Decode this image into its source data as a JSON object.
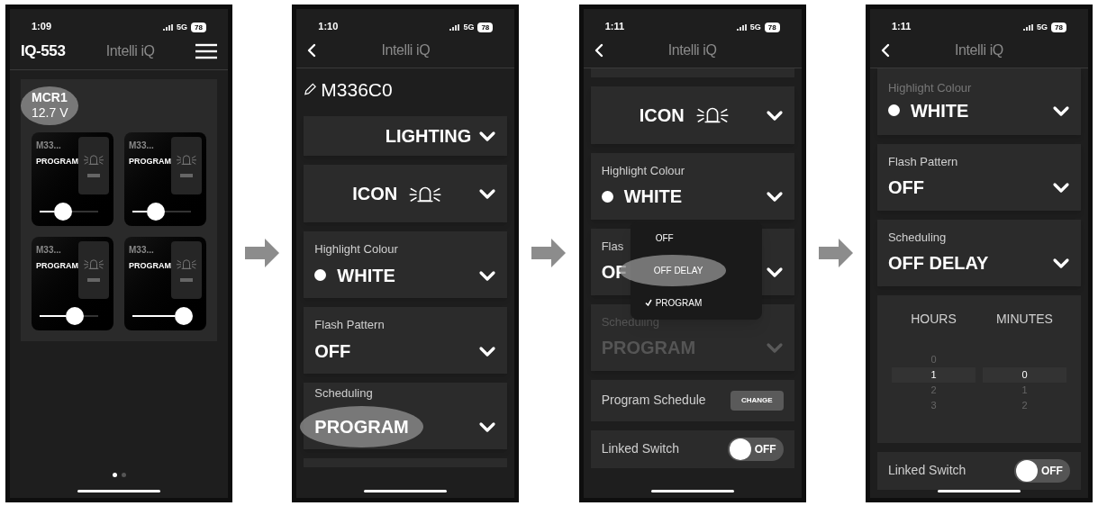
{
  "screens": [
    {
      "kind": "dashboard",
      "status": {
        "time": "1:09",
        "network": "5G",
        "battery": "78"
      },
      "device_code": "IQ-553",
      "app_title": "Intelli iQ",
      "controller": {
        "name": "MCR1",
        "voltage": "12.7 V",
        "highlighted": true
      },
      "switches": [
        {
          "name": "M33...",
          "mode": "PROGRAM",
          "level": 0.24
        },
        {
          "name": "M33...",
          "mode": "PROGRAM",
          "level": 0.24
        },
        {
          "name": "M33...",
          "mode": "PROGRAM",
          "level": 0.44
        },
        {
          "name": "M33...",
          "mode": "PROGRAM",
          "level": 0.73
        }
      ],
      "pages": [
        {
          "selected": true
        },
        {
          "selected": false
        }
      ]
    },
    {
      "kind": "detail",
      "status": {
        "time": "1:10",
        "network": "5G",
        "battery": "78"
      },
      "app_title": "Intelli iQ",
      "switch_name": "M336C0",
      "rows": [
        {
          "kind": "select",
          "value": "LIGHTING",
          "highlighted": false,
          "disabled": false
        },
        {
          "kind": "icon_select",
          "value": "ICON",
          "highlighted": false,
          "disabled": false
        },
        {
          "kind": "select",
          "label": "Highlight Colour",
          "value": "WHITE",
          "color": "#ffffff",
          "highlighted": false,
          "disabled": false
        },
        {
          "kind": "select",
          "label": "Flash Pattern",
          "value": "OFF",
          "highlighted": false,
          "disabled": false
        },
        {
          "kind": "select",
          "label": "Scheduling",
          "value": "PROGRAM",
          "highlighted": true,
          "disabled": false
        },
        {
          "kind": "blank"
        }
      ]
    },
    {
      "kind": "detail",
      "status": {
        "time": "1:11",
        "network": "5G",
        "battery": "78"
      },
      "app_title": "Intelli iQ",
      "rows": [
        {
          "kind": "blank"
        },
        {
          "kind": "icon_select",
          "value": "ICON",
          "highlighted": false,
          "disabled": false
        },
        {
          "kind": "select",
          "label": "Highlight Colour",
          "value": "WHITE",
          "color": "#ffffff",
          "highlighted": false,
          "disabled": false
        },
        {
          "kind": "select",
          "label": "Flas",
          "value": "OF",
          "highlighted": false,
          "disabled": false,
          "menu": [
            {
              "label": "OFF",
              "checked": false,
              "highlighted": false
            },
            {
              "label": "OFF DELAY",
              "checked": false,
              "highlighted": true
            },
            {
              "label": "PROGRAM",
              "checked": true,
              "highlighted": false
            }
          ]
        },
        {
          "kind": "select",
          "label": "Scheduling",
          "value": "PROGRAM",
          "highlighted": false,
          "disabled": true
        },
        {
          "kind": "button",
          "label": "Program Schedule",
          "button": "CHANGE"
        },
        {
          "kind": "toggle",
          "label": "Linked Switch",
          "on": false,
          "state": "OFF"
        }
      ]
    },
    {
      "kind": "detail",
      "status": {
        "time": "1:11",
        "network": "5G",
        "battery": "78"
      },
      "app_title": "Intelli iQ",
      "rows": [
        {
          "kind": "select",
          "label": "Highlight Colour",
          "value": "WHITE",
          "color": "#ffffff",
          "highlighted": false,
          "disabled": false,
          "partial": true
        },
        {
          "kind": "select",
          "label": "Flash Pattern",
          "value": "OFF",
          "highlighted": false,
          "disabled": false
        },
        {
          "kind": "select",
          "label": "Scheduling",
          "value": "OFF DELAY",
          "highlighted": false,
          "disabled": false
        },
        {
          "kind": "time_picker",
          "columns": [
            {
              "header": "HOURS",
              "values": [
                {
                  "text": "0",
                  "selected": false
                },
                {
                  "text": "1",
                  "selected": true
                },
                {
                  "text": "2",
                  "selected": false
                },
                {
                  "text": "3",
                  "selected": false
                }
              ]
            },
            {
              "header": "MINUTES",
              "values": [
                {
                  "text": "0",
                  "selected": true
                },
                {
                  "text": "1",
                  "selected": false
                },
                {
                  "text": "2",
                  "selected": false
                }
              ]
            }
          ]
        },
        {
          "kind": "toggle",
          "label": "Linked Switch",
          "on": false,
          "state": "OFF"
        }
      ]
    }
  ]
}
